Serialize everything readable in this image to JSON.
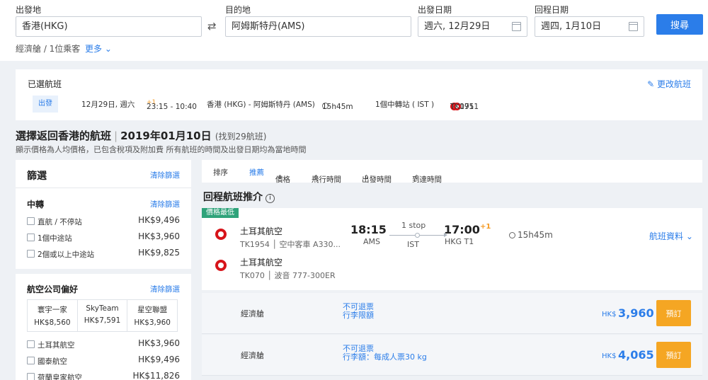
{
  "search": {
    "origin_label": "出發地",
    "origin_value": "香港(HKG)",
    "dest_label": "目的地",
    "dest_value": "阿姆斯特丹(AMS)",
    "depart_label": "出發日期",
    "depart_value": "週六, 12月29日",
    "return_label": "回程日期",
    "return_value": "週四, 1月10日",
    "search_button": "搜尋",
    "passengers": "經濟艙 / 1位乘客",
    "more": "更多"
  },
  "selected": {
    "title": "已選航班",
    "change": "更改航班",
    "tag": "出發",
    "date": "12月29日, 週六",
    "time": "23:15 - 10:40",
    "time_plus": "+1",
    "route": "香港 (HKG) - 阿姆斯特丹 (AMS)",
    "duration": "15h45m",
    "stops": "1個中轉站 ( IST )",
    "flight1": "TK071",
    "flight2": "TK1951"
  },
  "return": {
    "heading": "選擇返回香港的航班",
    "date": "2019年01月10日",
    "found": "(找到29航班)",
    "sub": "顯示價格為人均價格，已包含稅項及附加費 所有航班的時間及出發日期均為當地時間"
  },
  "filter": {
    "title": "篩選",
    "clear": "清除篩選",
    "transfer_title": "中轉",
    "transfer_options": [
      {
        "label": "直航 / 不停站",
        "price": "HK$9,496"
      },
      {
        "label": "1個中途站",
        "price": "HK$3,960"
      },
      {
        "label": "2個或以上中途站",
        "price": "HK$9,825"
      }
    ],
    "airline_title": "航空公司偏好",
    "alliances": [
      {
        "name": "寰宇一家",
        "price": "HK$8,560"
      },
      {
        "name": "SkyTeam",
        "price": "HK$7,591"
      },
      {
        "name": "星空聯盟",
        "price": "HK$3,960"
      }
    ],
    "airline_options": [
      {
        "label": "土耳其航空",
        "price": "HK$3,960"
      },
      {
        "label": "國泰航空",
        "price": "HK$9,496"
      },
      {
        "label": "荷蘭皇家航空",
        "price": "HK$11,826"
      }
    ]
  },
  "sort": {
    "label": "排序",
    "recommended": "推薦",
    "price": "價格",
    "duration": "飛行時間",
    "depart": "出發時間",
    "arrive": "到達時間"
  },
  "recommend_title": "回程航班推介",
  "flight": {
    "tag": "價格最低",
    "airline1": "土耳其航空",
    "flight1_info": "TK1954 │ 空中客車 A330...",
    "airline2": "土耳其航空",
    "flight2_info": "TK070 │ 波音 777-300ER",
    "dep_time": "18:15",
    "dep_apt": "AMS",
    "stop_label": "1 stop",
    "stop_apt": "IST",
    "arr_time": "17:00",
    "arr_plus": "+1",
    "arr_apt": "HKG T1",
    "duration": "15h45m",
    "details": "航班資料"
  },
  "fares": [
    {
      "cabin": "經濟艙",
      "rule1": "不可退票",
      "rule2": "行李限額",
      "currency": "HK$",
      "price": "3,960",
      "button": "預訂"
    },
    {
      "cabin": "經濟艙",
      "rule1": "不可退票",
      "rule2": "行李額：每成人票30 kg",
      "currency": "HK$",
      "price": "4,065",
      "button": "預訂"
    }
  ]
}
